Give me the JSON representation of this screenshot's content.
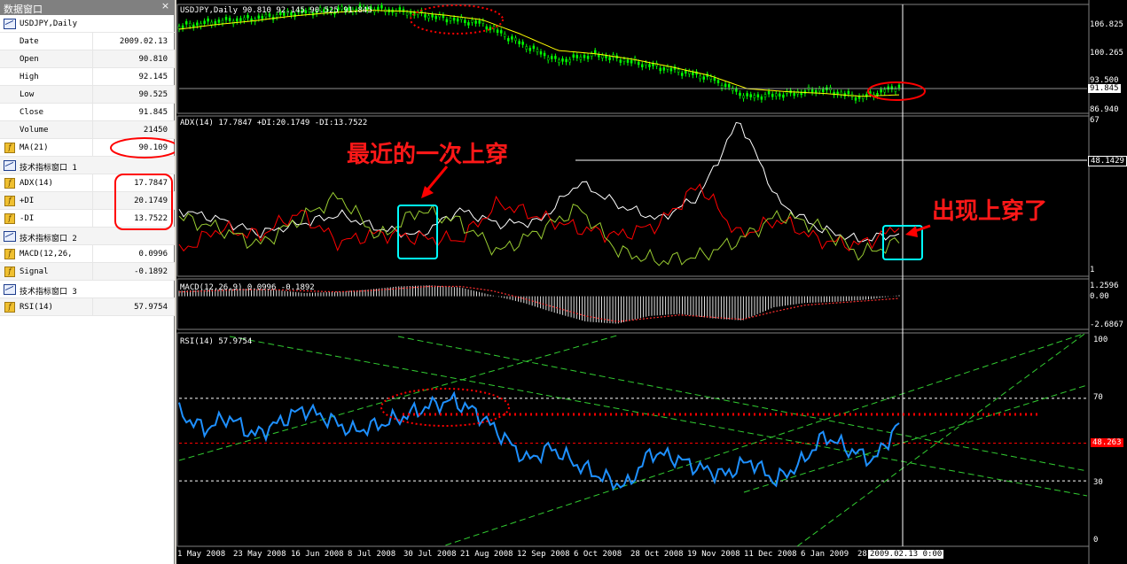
{
  "data_window": {
    "title": "数据窗口",
    "close_label": "×",
    "symbol": "USDJPY,Daily",
    "rows": [
      {
        "label": "Date",
        "value": "2009.02.13"
      },
      {
        "label": "Open",
        "value": "90.810"
      },
      {
        "label": "High",
        "value": "92.145"
      },
      {
        "label": "Low",
        "value": "90.525"
      },
      {
        "label": "Close",
        "value": "91.845"
      },
      {
        "label": "Volume",
        "value": "21450"
      }
    ],
    "ma": {
      "label": "MA(21)",
      "value": "90.109"
    },
    "window1": {
      "label": "技术指标窗口 1"
    },
    "adx": [
      {
        "label": "ADX(14)",
        "value": "17.7847"
      },
      {
        "label": "+DI",
        "value": "20.1749"
      },
      {
        "label": "-DI",
        "value": "13.7522"
      }
    ],
    "window2": {
      "label": "技术指标窗口 2"
    },
    "macd": [
      {
        "label": "MACD(12,26,",
        "value": "0.0996"
      },
      {
        "label": "Signal",
        "value": "-0.1892"
      }
    ],
    "window3": {
      "label": "技术指标窗口 3"
    },
    "rsi": {
      "label": "RSI(14)",
      "value": "57.9754"
    }
  },
  "chart": {
    "price_title": "USDJPY,Daily  90.810 92.145 90.525 91.845",
    "adx_title": "ADX(14) 17.7847 +DI:20.1749 -DI:13.7522",
    "macd_title": "MACD(12,26,9) 0.0996 -0.1892",
    "rsi_title": "RSI(14) 57.9754",
    "price_axis": [
      "106.825",
      "100.265",
      "93.500",
      "86.940"
    ],
    "current_price": "91.845",
    "adx_axis": [
      "67",
      "48.1429",
      "1"
    ],
    "macd_axis": [
      "1.2596",
      "0.00",
      "-2.6867"
    ],
    "rsi_axis": [
      "100",
      "70",
      "30",
      "0"
    ],
    "rsi_level": "48.263",
    "dates": [
      "1 May 2008",
      "23 May 2008",
      "16 Jun 2008",
      "8 Jul 2008",
      "30 Jul 2008",
      "21 Aug 2008",
      "12 Sep 2008",
      "6 Oct 2008",
      "28 Oct 2008",
      "19 Nov 2008",
      "11 Dec 2008",
      "6 Jan 2009",
      "28"
    ],
    "cursor_date": "2009.02.13 0:00",
    "annotation_recent_cross": "最近的一次上穿",
    "annotation_cross_now": "出现上穿了",
    "colors": {
      "up_bar": "#00ff00",
      "ma_line": "#ffff00",
      "adx_line": "#ffffff",
      "plus_di": "#ff0000",
      "minus_di": "#9acd32",
      "rsi_line": "#1e90ff",
      "highlight_box": "#00ffff",
      "annotation": "#ff0000"
    }
  },
  "chart_data": [
    {
      "type": "line",
      "title": "USDJPY,Daily",
      "series": [
        {
          "name": "USDJPY",
          "values": [
            104.5,
            105.6,
            106.2,
            107.4,
            107.9,
            108.4,
            107.6,
            106.3,
            105.2,
            101.0,
            97.2,
            98.6,
            97.0,
            95.4,
            93.7,
            89.6,
            90.2,
            91.2,
            89.4,
            91.845
          ]
        },
        {
          "name": "MA(21)",
          "values": [
            104.0,
            105.0,
            105.8,
            106.8,
            107.5,
            108.0,
            107.8,
            107.0,
            106.0,
            103.0,
            99.5,
            98.8,
            97.6,
            96.0,
            94.2,
            91.4,
            90.8,
            90.4,
            89.8,
            90.109
          ]
        }
      ],
      "ylim": [
        86.94,
        108.5
      ]
    },
    {
      "type": "line",
      "title": "ADX(14)",
      "series": [
        {
          "name": "ADX",
          "values": [
            28,
            24,
            18,
            22,
            26,
            20,
            17,
            28,
            22,
            23,
            40,
            30,
            24,
            34,
            67,
            31,
            20,
            15,
            17.78
          ]
        },
        {
          "name": "+DI",
          "values": [
            10,
            20,
            17,
            27,
            14,
            18,
            16,
            15,
            31,
            25,
            20,
            17,
            22,
            39,
            17,
            24,
            15,
            13,
            20.17
          ]
        },
        {
          "name": "-DI",
          "values": [
            25,
            20,
            13,
            24,
            34,
            16,
            28,
            23,
            10,
            19,
            29,
            10,
            6,
            8,
            15,
            26,
            21,
            9,
            13.75
          ]
        }
      ],
      "ylim": [
        1,
        67
      ]
    },
    {
      "type": "bar",
      "title": "MACD(12,26,9)",
      "series": [
        {
          "name": "MACD",
          "values": [
            0.5,
            0.6,
            0.7,
            0.6,
            0.3,
            0.4,
            0.6,
            0.9,
            1.0,
            0.8,
            0.1,
            -0.6,
            -1.5,
            -2.3,
            -2.5,
            -1.8,
            -1.6,
            -2.0,
            -2.2,
            -1.0,
            -0.6,
            -0.5,
            -0.3,
            0.0996
          ]
        },
        {
          "name": "Signal",
          "values": [
            0.4,
            0.5,
            0.6,
            0.6,
            0.5,
            0.4,
            0.5,
            0.7,
            0.9,
            0.9,
            0.5,
            -0.2,
            -1.0,
            -1.8,
            -2.3,
            -2.0,
            -1.7,
            -1.9,
            -2.1,
            -1.4,
            -0.8,
            -0.6,
            -0.4,
            -0.1892
          ]
        }
      ],
      "ylim": [
        -2.6867,
        1.2596
      ]
    },
    {
      "type": "line",
      "title": "RSI(14)",
      "series": [
        {
          "name": "RSI",
          "values": [
            63,
            55,
            61,
            52,
            58,
            65,
            60,
            54,
            57,
            61,
            66,
            69,
            63,
            52,
            40,
            46,
            38,
            32,
            27,
            44,
            41,
            36,
            33,
            40,
            30,
            38,
            52,
            45,
            40,
            57.98
          ]
        }
      ],
      "ylim": [
        0,
        100
      ],
      "levels": [
        70,
        30,
        48.263
      ]
    }
  ]
}
